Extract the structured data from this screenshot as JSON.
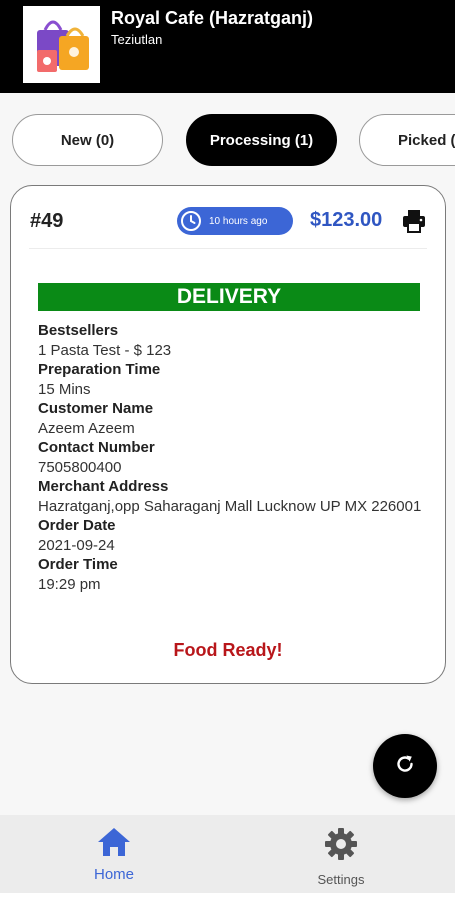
{
  "header": {
    "store_name": "Royal Cafe (Hazratganj)",
    "store_city": "Teziutlan",
    "logo_icon": "shopping-bags-icon"
  },
  "tabs": [
    {
      "label": "New (0)",
      "active": false
    },
    {
      "label": "Processing (1)",
      "active": true
    },
    {
      "label": "Picked (",
      "active": false
    }
  ],
  "order": {
    "number": "#49",
    "time_ago": "10 hours ago",
    "price": "$123.00",
    "type": "DELIVERY",
    "type_color": "#0a8a16",
    "details": [
      {
        "label": "Bestsellers",
        "value": "1 Pasta Test - $ 123"
      },
      {
        "label": "Preparation Time",
        "value": "15 Mins"
      },
      {
        "label": "Customer Name",
        "value": "Azeem Azeem"
      },
      {
        "label": "Contact Number",
        "value": "7505800400"
      },
      {
        "label": "Merchant Address",
        "value": "Hazratganj,opp Saharaganj Mall Lucknow UP MX 226001"
      },
      {
        "label": "Order Date",
        "value": "2021-09-24"
      },
      {
        "label": "Order Time",
        "value": "19:29 pm"
      }
    ],
    "status_action": "Food Ready!",
    "status_color": "#b8161a"
  },
  "fab": {
    "icon": "refresh-icon"
  },
  "bottom_nav": [
    {
      "label": "Home",
      "icon": "home-icon",
      "active": true
    },
    {
      "label": "Settings",
      "icon": "gear-icon",
      "active": false
    }
  ],
  "colors": {
    "accent": "#3c66d6",
    "price": "#2f56c2",
    "header_bg": "#000000"
  }
}
